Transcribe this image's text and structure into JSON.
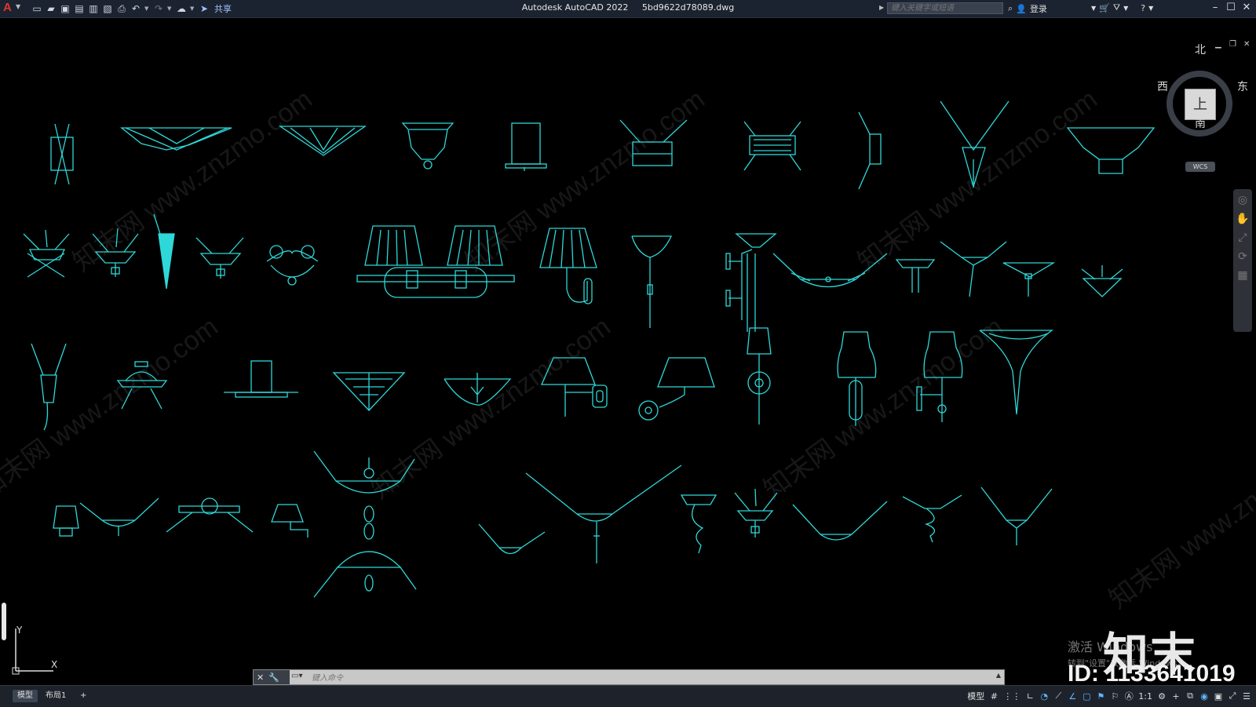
{
  "app": {
    "title": "Autodesk AutoCAD 2022",
    "filename": "5bd9622d78089.dwg"
  },
  "quick_access": {
    "icons": [
      "new-icon",
      "open-icon",
      "save-icon",
      "saveas-icon",
      "publish-icon",
      "plot-preview-icon",
      "print-icon",
      "undo-icon",
      "redo-icon",
      "share-cloud-icon"
    ],
    "share_label": "共享"
  },
  "search": {
    "placeholder": "键入关键字或短语"
  },
  "account": {
    "login_label": "登录"
  },
  "viewcube": {
    "face": "上",
    "north": "北",
    "south": "南",
    "east": "东",
    "west": "西",
    "wcs": "WCS"
  },
  "ucs": {
    "x_label": "X",
    "y_label": "Y"
  },
  "watermark_text": "知末网 www.znzmo.com",
  "activate": {
    "line1": "激活 Windows",
    "line2": "转到\"设置\"以激活 Windows。"
  },
  "brand": {
    "logo": "知末",
    "id": "ID: 1133641019"
  },
  "command": {
    "placeholder": "键入命令"
  },
  "layout_tabs": [
    "模型",
    "布局1",
    "+"
  ],
  "status": {
    "model_label": "模型",
    "scale_label": "1:1",
    "tools": [
      "grid-icon",
      "snap-icon",
      "ortho-icon",
      "polar-icon",
      "osnap-icon",
      "otrack-icon",
      "lineweight-icon",
      "transparency-icon",
      "annotation-icon",
      "workspace-icon",
      "plus-icon",
      "isolate-icon",
      "hardware-icon",
      "fullscreen-icon",
      "customize-icon"
    ]
  },
  "drawing": {
    "line_color": "#2fd8d8",
    "items": [
      {
        "id": "wall-lamp-1",
        "type": "cyl-spikes"
      },
      {
        "id": "wall-lamp-2",
        "type": "fan-shade"
      },
      {
        "id": "wall-lamp-3",
        "type": "bowl"
      },
      {
        "id": "wall-lamp-4",
        "type": "cup-pendant"
      },
      {
        "id": "wall-lamp-5",
        "type": "box"
      },
      {
        "id": "wall-lamp-6",
        "type": "box-spikes"
      },
      {
        "id": "wall-lamp-7",
        "type": "crystal-box"
      },
      {
        "id": "wall-lamp-8",
        "type": "slim"
      },
      {
        "id": "wall-lamp-9",
        "type": "v-cone"
      },
      {
        "id": "wall-lamp-10",
        "type": "urn"
      }
    ]
  }
}
